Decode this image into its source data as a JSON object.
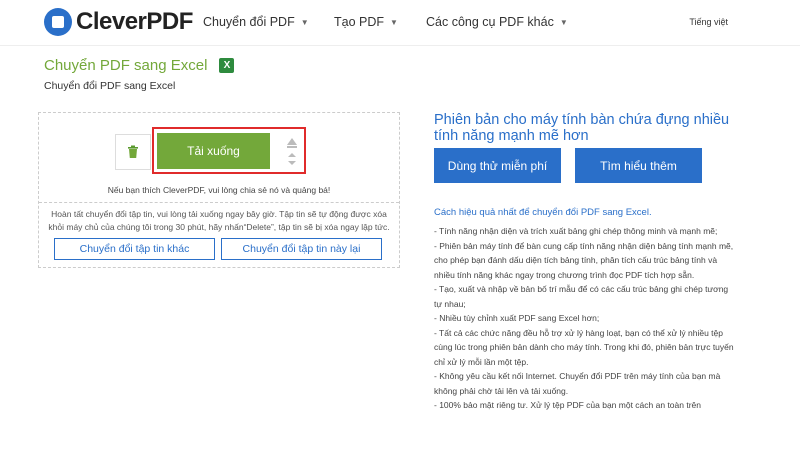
{
  "header": {
    "logo_text": "CleverPDF",
    "nav": [
      {
        "label": "Chuyển đổi PDF"
      },
      {
        "label": "Tạo PDF"
      },
      {
        "label": "Các công cụ PDF khác"
      }
    ],
    "language": "Tiếng việt"
  },
  "page": {
    "title": "Chuyển PDF sang Excel",
    "title_icon": "excel-icon",
    "subtitle": "Chuyển đổi PDF sang Excel"
  },
  "panel": {
    "download_label": "Tải xuống",
    "share_note": "Nếu bạn thích CleverPDF, vui lòng chia sẻ nó và quảng bá!",
    "done_note": "Hoàn tất chuyển đổi tập tin, vui lòng tải xuống ngay bây giờ. Tập tin sẽ tự động được xóa khỏi máy chủ của chúng tôi trong 30 phút, hãy nhấn“Delete”, tập tin sẽ bị xóa ngay lập tức.",
    "convert_other_label": "Chuyển đổi tập tin khác",
    "convert_again_label": "Chuyển đổi tập tin này lại",
    "highlight_color": "#e02b2b",
    "accent_color": "#73a83a"
  },
  "promo": {
    "title": "Phiên bản cho máy tính bàn chứa đựng nhiều tính năng mạnh mẽ hơn",
    "try_free_label": "Dùng thử miễn phí",
    "learn_more_label": "Tìm hiểu thêm",
    "brand_color": "#2a6fc9"
  },
  "tips": {
    "title": "Cách hiệu quả nhất để chuyển đổi PDF sang Excel.",
    "lines": [
      "- Tính năng nhận diện và trích xuất bảng ghi chép thông minh và mạnh mẽ;",
      "- Phiên bản máy tính để bàn cung cấp tính năng nhận diện bảng tính mạnh mẽ, cho phép bạn đánh dấu diện tích bảng tính, phân tích cấu trúc bảng tính và nhiều tính năng khác ngay trong chương trình đọc PDF tích hợp sẵn.",
      "- Tạo, xuất và nhập về bản bố trí mẫu để có các cấu trúc bảng ghi chép tương tự nhau;",
      "- Nhiều tùy chỉnh xuất PDF sang Excel hơn;",
      "- Tất cả các chức năng đều hỗ trợ xử lý hàng loạt, bạn có thể xử lý nhiều tệp cùng lúc trong phiên bản dành cho máy tính. Trong khi đó, phiên bản trực tuyến chỉ xử lý mỗi lần một tệp.",
      "- Không yêu cầu kết nối Internet. Chuyển đổi PDF trên máy tính của bạn mà không phải chờ tải lên và tải xuống.",
      "- 100% bảo mật riêng tư. Xử lý tệp PDF của bạn một cách an toàn trên"
    ]
  }
}
